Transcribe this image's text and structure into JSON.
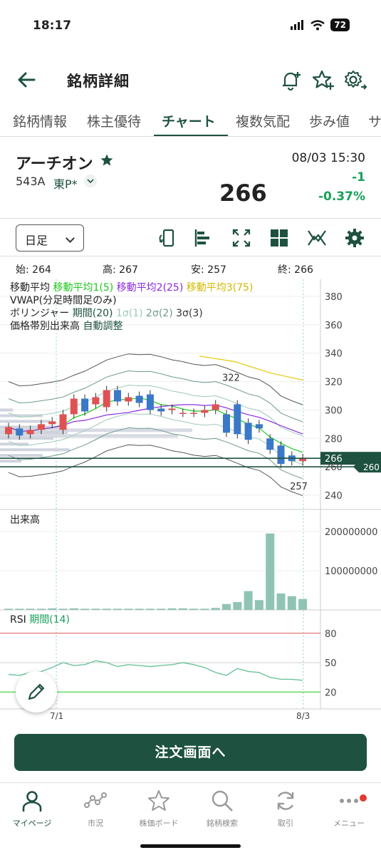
{
  "status": {
    "time": "18:17",
    "battery": "72"
  },
  "header": {
    "title": "銘柄詳細"
  },
  "tabs": [
    "銘柄情報",
    "株主優待",
    "チャート",
    "複数気配",
    "歩み値",
    "サ"
  ],
  "stock": {
    "name": "アーチオン",
    "code": "543A",
    "market": "東P*",
    "timestamp": "08/03 15:30",
    "price": "266",
    "change": "-1",
    "change_pct": "-0.37%"
  },
  "toolbar": {
    "period": "日足"
  },
  "ohlc": {
    "open": "始: 264",
    "high": "高: 267",
    "low": "安: 257",
    "close": "終: 266"
  },
  "legend": {
    "ma_label": "移動平均",
    "ma1": "移動平均1(5)",
    "ma2": "移動平均2(25)",
    "ma3": "移動平均3(75)",
    "vwap": "VWAP(分足時間足のみ)",
    "bb_label": "ボリンジャー",
    "bb_period": "期間(20)",
    "bb_s1": "1σ(1)",
    "bb_s2": "2σ(2)",
    "bb_s3": "3σ(3)",
    "vp_label": "価格帯別出来高",
    "vp_mode": "自動調整"
  },
  "volume_label": "出来高",
  "rsi": {
    "label": "RSI",
    "period": "期間(14)"
  },
  "colors": {
    "brand": "#1e5140",
    "up": "#e05252",
    "down": "#3a78c8",
    "ma1": "#1ec81e",
    "ma2": "#8a2be2",
    "ma3": "#e6c800",
    "volume": "#8fc4b4",
    "rsi": "#6cc49a"
  },
  "chart_data": [
    {
      "type": "candlestick",
      "title": "",
      "y_ticks": [
        240,
        260,
        280,
        300,
        320,
        340,
        360,
        380
      ],
      "ylim": [
        230,
        392
      ],
      "x_labels": [
        "7/1",
        "8/3"
      ],
      "current_price_label": "266",
      "crosshair_label": "260",
      "high_annotation": "322",
      "low_annotation": "257",
      "candles": [
        {
          "o": 283,
          "c": 288
        },
        {
          "o": 287,
          "c": 282
        },
        {
          "o": 283,
          "c": 286
        },
        {
          "o": 286,
          "c": 290
        },
        {
          "o": 290,
          "c": 292
        },
        {
          "o": 286,
          "c": 297
        },
        {
          "o": 297,
          "c": 308
        },
        {
          "o": 308,
          "c": 299
        },
        {
          "o": 304,
          "c": 309
        },
        {
          "o": 302,
          "c": 314
        },
        {
          "o": 314,
          "c": 306
        },
        {
          "o": 306,
          "c": 309
        },
        {
          "o": 310,
          "c": 305
        },
        {
          "o": 311,
          "c": 300
        },
        {
          "o": 301,
          "c": 299
        },
        {
          "o": 300,
          "c": 301
        },
        {
          "o": 298,
          "c": 298
        },
        {
          "o": 298,
          "c": 298
        },
        {
          "o": 298,
          "c": 300
        },
        {
          "o": 300,
          "c": 304
        },
        {
          "o": 297,
          "c": 284
        },
        {
          "o": 304,
          "c": 283
        },
        {
          "o": 291,
          "c": 279
        },
        {
          "o": 290,
          "c": 287
        },
        {
          "o": 280,
          "c": 272
        },
        {
          "o": 275,
          "c": 262
        },
        {
          "o": 268,
          "c": 264
        },
        {
          "o": 264,
          "c": 266
        }
      ]
    },
    {
      "type": "bar",
      "title": "出来高",
      "y_ticks": [
        100000000,
        200000000
      ],
      "y_tick_labels": [
        "100000000",
        "200000000"
      ],
      "values": [
        3000000,
        3000000,
        3000000,
        3000000,
        4000000,
        3000000,
        4000000,
        3000000,
        3000000,
        3000000,
        3000000,
        3000000,
        3000000,
        3000000,
        3000000,
        4000000,
        4000000,
        3000000,
        3000000,
        5000000,
        15000000,
        20000000,
        48000000,
        25000000,
        195000000,
        42000000,
        35000000,
        28000000
      ]
    },
    {
      "type": "line",
      "title": "RSI",
      "y_ticks": [
        20,
        50,
        80
      ],
      "values": [
        38,
        37,
        40,
        41,
        45,
        50,
        47,
        48,
        52,
        50,
        46,
        48,
        47,
        46,
        47,
        48,
        50,
        48,
        45,
        40,
        37,
        44,
        41,
        40,
        35,
        33,
        33,
        32
      ]
    }
  ]
}
